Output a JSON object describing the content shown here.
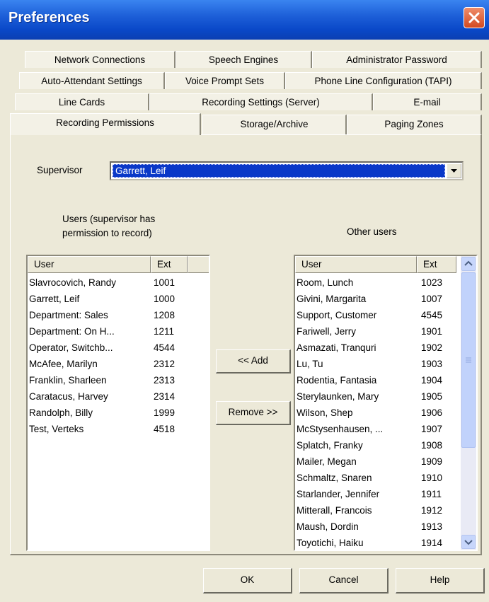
{
  "window": {
    "title": "Preferences"
  },
  "tabs": {
    "row1": [
      "Network Connections",
      "Speech Engines",
      "Administrator Password"
    ],
    "row2": [
      "Auto-Attendant Settings",
      "Voice Prompt Sets",
      "Phone Line Configuration (TAPI)"
    ],
    "row3": [
      "Line Cards",
      "Recording Settings (Server)",
      "E-mail"
    ],
    "row4": [
      "Recording Permissions",
      "Storage/Archive",
      "Paging Zones"
    ]
  },
  "supervisor": {
    "label": "Supervisor",
    "value": "Garrett, Leif"
  },
  "left_list": {
    "caption": [
      "Users (supervisor has",
      "permission to record)"
    ],
    "columns": [
      "User",
      "Ext"
    ],
    "rows": [
      [
        "Slavrocovich, Randy",
        "1001"
      ],
      [
        "Garrett, Leif",
        "1000"
      ],
      [
        "Department: Sales",
        "1208"
      ],
      [
        "Department: On H...",
        "1211"
      ],
      [
        "Operator, Switchb...",
        "4544"
      ],
      [
        "McAfee, Marilyn",
        "2312"
      ],
      [
        "Franklin, Sharleen",
        "2313"
      ],
      [
        "Caratacus, Harvey",
        "2314"
      ],
      [
        "Randolph, Billy",
        "1999"
      ],
      [
        "Test, Verteks",
        "4518"
      ]
    ]
  },
  "right_list": {
    "caption": "Other users",
    "columns": [
      "User",
      "Ext"
    ],
    "rows": [
      [
        "Room, Lunch",
        "1023"
      ],
      [
        "Givini, Margarita",
        "1007"
      ],
      [
        "Support, Customer",
        "4545"
      ],
      [
        "Fariwell, Jerry",
        "1901"
      ],
      [
        "Asmazati, Tranquri",
        "1902"
      ],
      [
        "Lu, Tu",
        "1903"
      ],
      [
        "Rodentia, Fantasia",
        "1904"
      ],
      [
        "Sterylaunken, Mary",
        "1905"
      ],
      [
        "Wilson, Shep",
        "1906"
      ],
      [
        "McStysenhausen, ...",
        "1907"
      ],
      [
        "Splatch, Franky",
        "1908"
      ],
      [
        "Mailer, Megan",
        "1909"
      ],
      [
        "Schmaltz, Snaren",
        "1910"
      ],
      [
        "Starlander, Jennifer",
        "1911"
      ],
      [
        "Mitterall, Francois",
        "1912"
      ],
      [
        "Maush, Dordin",
        "1913"
      ],
      [
        "Toyotichi, Haiku",
        "1914"
      ]
    ]
  },
  "buttons": {
    "add": "<< Add",
    "remove": "Remove >>",
    "ok": "OK",
    "cancel": "Cancel",
    "help": "Help"
  },
  "colors": {
    "titlebar": "#0a48c8",
    "selection": "#0a38c8",
    "dialog": "#ece9d8",
    "close": "#d34a21"
  }
}
